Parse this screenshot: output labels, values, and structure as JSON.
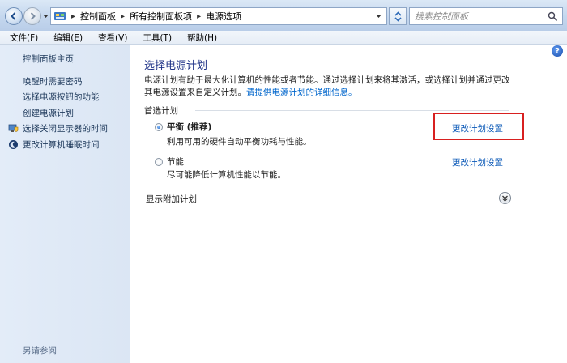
{
  "address": {
    "breadcrumbs": [
      "控制面板",
      "所有控制面板项",
      "电源选项"
    ],
    "search_placeholder": "搜索控制面板"
  },
  "menu": [
    "文件(F)",
    "编辑(E)",
    "查看(V)",
    "工具(T)",
    "帮助(H)"
  ],
  "sidebar": {
    "home": "控制面板主页",
    "items": [
      "唤醒时需要密码",
      "选择电源按钮的功能",
      "创建电源计划",
      "选择关闭显示器的时间",
      "更改计算机睡眠时间"
    ],
    "see_also": "另请参阅"
  },
  "main": {
    "title": "选择电源计划",
    "description": "电源计划有助于最大化计算机的性能或者节能。通过选择计划来将其激活，或选择计划并通过更改其电源设置来自定义计划。",
    "description_link": "请提供电源计划的详细信息。",
    "preferred_header": "首选计划",
    "plans": [
      {
        "name": "平衡 (推荐)",
        "desc": "利用可用的硬件自动平衡功耗与性能。",
        "link": "更改计划设置",
        "selected": true
      },
      {
        "name": "节能",
        "desc": "尽可能降低计算机性能以节能。",
        "link": "更改计划设置",
        "selected": false
      }
    ],
    "more_plans": "显示附加计划"
  },
  "help_label": "?"
}
